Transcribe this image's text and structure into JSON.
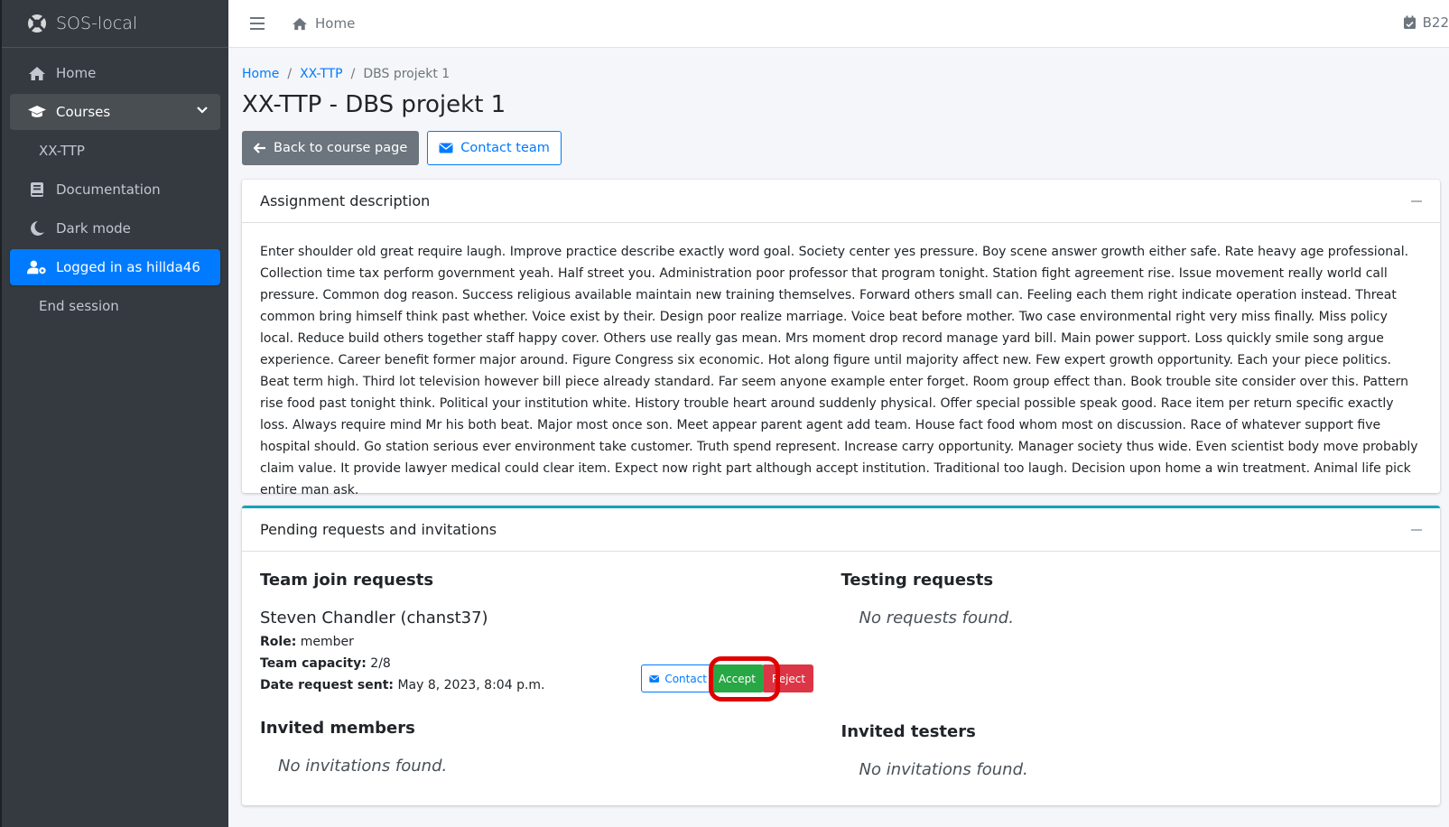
{
  "brand": {
    "name": "SOS-local",
    "icon": "lifebuoy-icon"
  },
  "sidebar": {
    "items": [
      {
        "label": "Home",
        "icon": "home-icon"
      },
      {
        "label": "Courses",
        "icon": "graduation-cap-icon"
      },
      {
        "label": "XX-TTP"
      },
      {
        "label": "Documentation",
        "icon": "book-icon"
      },
      {
        "label": "Dark mode",
        "icon": "moon-icon"
      },
      {
        "label": "Logged in as hillda46",
        "icon": "user-cog-icon"
      },
      {
        "label": "End session"
      }
    ]
  },
  "topbar": {
    "home_label": "Home",
    "right_label": "B22"
  },
  "breadcrumb": {
    "items": [
      "Home",
      "XX-TTP",
      "DBS projekt 1"
    ],
    "separator": "/"
  },
  "page": {
    "title": "XX-TTP - DBS projekt 1",
    "back_button": "Back to course page",
    "contact_button": "Contact team"
  },
  "assignment": {
    "header": "Assignment description",
    "text": "Enter shoulder old great require laugh. Improve practice describe exactly word goal. Society center yes pressure. Boy scene answer growth either safe. Rate heavy age professional. Collection time tax perform government yeah. Half street you. Administration poor professor that program tonight. Station fight agreement rise. Issue movement really world call pressure. Common dog reason. Success religious available maintain new training themselves. Forward others small can. Feeling each them right indicate operation instead. Threat common bring himself think past whether. Voice exist by their. Design poor realize marriage. Voice beat before mother. Two case environmental right very miss finally. Miss policy local. Reduce build others together staff happy cover. Others use really gas mean. Mrs moment drop record manage yard bill. Main power support. Loss quickly smile song argue experience. Career benefit former major around. Figure Congress six economic. Hot along figure until majority affect new. Few expert growth opportunity. Each your piece politics. Beat term high. Third lot television however bill piece already standard. Far seem anyone example enter forget. Room group effect than. Book trouble site consider over this. Pattern rise food past tonight think. Political your institution white. History trouble heart around suddenly physical. Offer special possible speak good. Race item per return specific exactly loss. Always require mind Mr his both beat. Major most once son. Meet appear parent agent add team. House fact food whom most on discussion. Race of whatever support five hospital should. Go station serious ever environment take customer. Truth spend represent. Increase carry opportunity. Manager society thus wide. Even scientist body move probably claim value. It provide lawyer medical could clear item. Expect now right part although accept institution. Traditional too laugh. Decision upon home a win treatment. Animal life pick entire man ask."
  },
  "pending": {
    "header": "Pending requests and invitations",
    "team_join": {
      "title": "Team join requests",
      "request": {
        "name": "Steven Chandler (chanst37)",
        "role_label": "Role:",
        "role": "member",
        "capacity_label": "Team capacity:",
        "capacity": "2/8",
        "date_label": "Date request sent:",
        "date": "May 8, 2023, 8:04 p.m.",
        "contact": "Contact",
        "accept": "Accept",
        "reject": "Reject"
      }
    },
    "testing": {
      "title": "Testing requests",
      "empty": "No requests found."
    },
    "invited_members": {
      "title": "Invited members",
      "empty": "No invitations found."
    },
    "invited_testers": {
      "title": "Invited testers",
      "empty": "No invitations found."
    }
  },
  "colors": {
    "sidebar": "#343a40",
    "primary": "#007bff",
    "success": "#28a745",
    "danger": "#dc3545",
    "highlight": "#e00000"
  }
}
